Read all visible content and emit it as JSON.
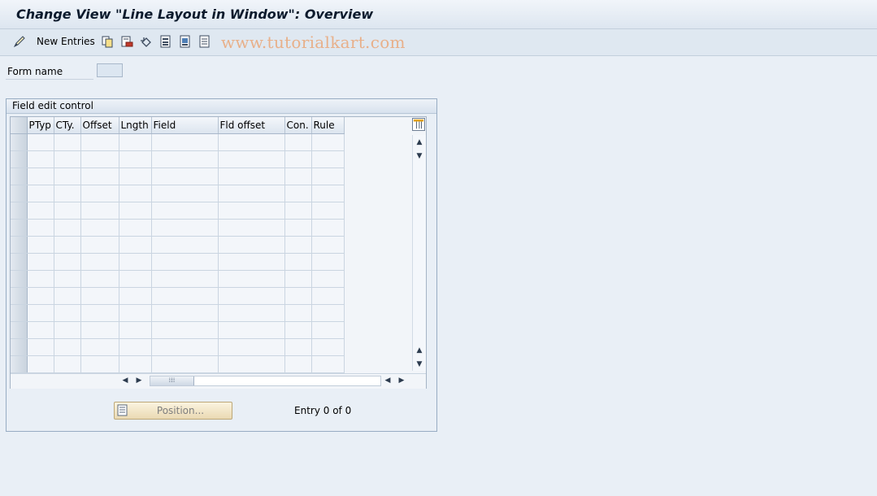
{
  "window": {
    "title": "Change View \"Line Layout in Window\": Overview"
  },
  "toolbar": {
    "new_entries_label": "New Entries",
    "icons": [
      "pencil-glasses-icon",
      "copy-icon",
      "delete-icon",
      "undo-icon",
      "select-all-icon",
      "select-block-icon",
      "deselect-all-icon"
    ]
  },
  "watermark": "www.tutorialkart.com",
  "form": {
    "form_name_label": "Form name",
    "form_name_value": ""
  },
  "group": {
    "title": "Field edit control",
    "columns": [
      "PTyp",
      "CTy.",
      "Offset",
      "Lngth",
      "Field",
      "Fld offset",
      "Con.",
      "Rule"
    ],
    "row_count": 14,
    "position_button_label": "Position...",
    "entry_text": "Entry 0 of 0"
  }
}
